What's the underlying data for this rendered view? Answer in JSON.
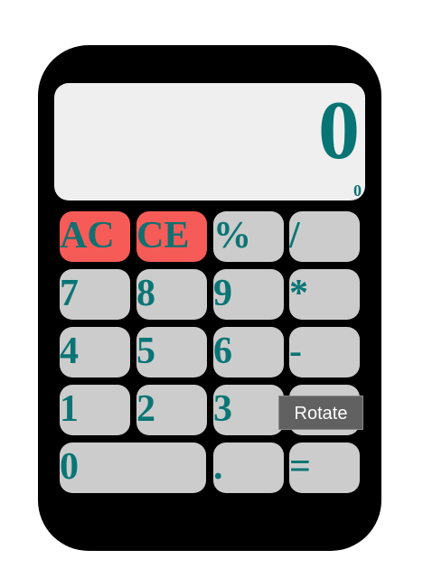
{
  "calculator": {
    "display": {
      "value": "0",
      "history": "0"
    },
    "keys": [
      {
        "label": "AC"
      },
      {
        "label": "CE"
      },
      {
        "label": "%"
      },
      {
        "label": "/"
      },
      {
        "label": "7"
      },
      {
        "label": "8"
      },
      {
        "label": "9"
      },
      {
        "label": "*"
      },
      {
        "label": "4"
      },
      {
        "label": "5"
      },
      {
        "label": "6"
      },
      {
        "label": "-"
      },
      {
        "label": "1"
      },
      {
        "label": "2"
      },
      {
        "label": "3"
      },
      {
        "label": ""
      },
      {
        "label": "0"
      },
      {
        "label": "."
      },
      {
        "label": "="
      }
    ]
  },
  "tooltip": {
    "text": "Rotate"
  },
  "colors": {
    "body": "#000000",
    "display_bg": "#efefef",
    "text_accent": "#097474",
    "key_bg": "#cccccc",
    "clear_key_bg": "#f75b57",
    "tooltip_bg": "#616161"
  }
}
